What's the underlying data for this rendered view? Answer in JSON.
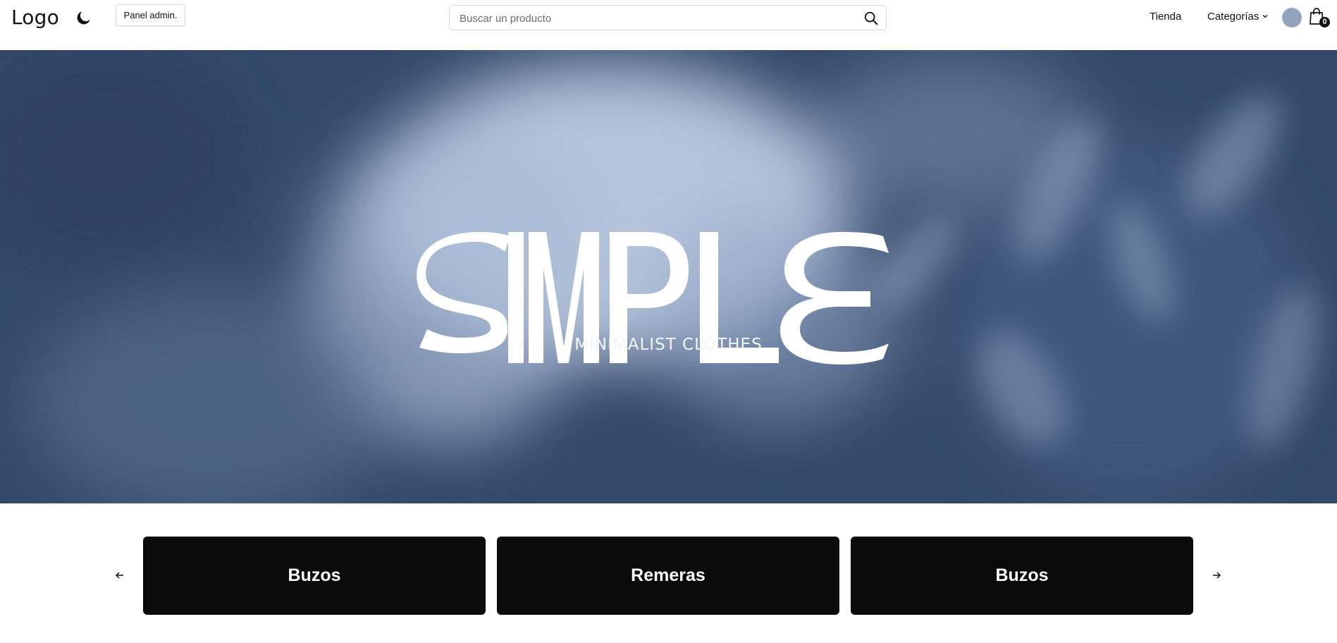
{
  "header": {
    "logo_text": "Logo",
    "theme_toggle_icon": "moon-icon",
    "admin_label": "Panel admin.",
    "search": {
      "placeholder": "Buscar un producto",
      "value": "",
      "icon": "search-icon"
    },
    "nav": {
      "store_label": "Tienda",
      "categories_label": "Categorías",
      "categories_icon": "chevron-down-icon"
    },
    "avatar_icon": "avatar",
    "cart": {
      "icon": "shopping-bag-icon",
      "count": "0"
    }
  },
  "hero": {
    "brand_wordmark": "SIMPLE",
    "subtitle": "MINIMALIST CLOTHES",
    "background_color": "#34496a"
  },
  "categories": {
    "prev_icon": "arrow-left-icon",
    "next_icon": "arrow-right-icon",
    "items": [
      {
        "label": "Buzos"
      },
      {
        "label": "Remeras"
      },
      {
        "label": "Buzos"
      }
    ],
    "card_color": "#0b0b0b"
  }
}
